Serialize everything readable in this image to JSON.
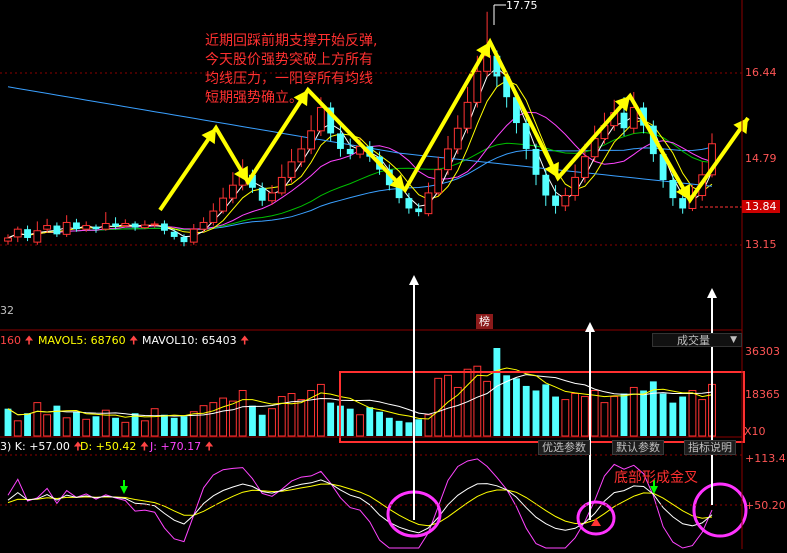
{
  "colors": {
    "bg": "#000000",
    "up": "#ff3333",
    "down": "#54ffff",
    "ma_white": "#ffffff",
    "ma_yellow": "#ffff00",
    "ma_magenta": "#ff44ff",
    "ma_green": "#00c000",
    "ma_blue": "#3aa0ff",
    "annotation": "#ff3030",
    "arrow_yellow": "#ffff00",
    "circle": "#ff33ff",
    "grid": "#8b0000"
  },
  "price_panel": {
    "high_marker": "17.75",
    "axis_labels": [
      "16.44",
      "14.79",
      "13.84",
      "13.15"
    ],
    "current_price": "13.84",
    "cut_label": "32",
    "annotation": [
      "近期回踩前期支撑开始反弹,",
      "今天股价强势突破上方所有",
      "均线压力，一阳穿所有均线",
      "短期强势确立。"
    ]
  },
  "volume_panel": {
    "legend": [
      {
        "text": "160",
        "color": "#ff4444"
      },
      {
        "text": "MAVOL5: 68760",
        "color": "#ffff00"
      },
      {
        "text": "MAVOL10: 65403",
        "color": "#ffffff"
      }
    ],
    "badge": "榜",
    "dropdown": "成交量",
    "axis_labels": [
      "36303",
      "18365",
      "X10"
    ],
    "buttons": [
      "优选参数",
      "默认参数",
      "指标说明"
    ]
  },
  "kdj_panel": {
    "legend": [
      {
        "text": "3) K: +57.00",
        "color": "#ffffff"
      },
      {
        "text": "D: +50.42",
        "color": "#ffff00"
      },
      {
        "text": "J: +70.17",
        "color": "#ff44ff"
      }
    ],
    "axis_labels": [
      "+113.4",
      "+50.20"
    ],
    "annotation": "底部形成金叉"
  },
  "chart_data": {
    "type": "candlestick",
    "ylim": [
      12.8,
      17.9
    ],
    "candles": [
      {
        "o": 13.32,
        "c": 13.38,
        "h": 13.45,
        "l": 13.25
      },
      {
        "o": 13.4,
        "c": 13.55,
        "h": 13.6,
        "l": 13.3
      },
      {
        "o": 13.55,
        "c": 13.38,
        "h": 13.62,
        "l": 13.32
      },
      {
        "o": 13.3,
        "c": 13.52,
        "h": 13.7,
        "l": 13.25
      },
      {
        "o": 13.55,
        "c": 13.62,
        "h": 13.75,
        "l": 13.48
      },
      {
        "o": 13.62,
        "c": 13.45,
        "h": 13.68,
        "l": 13.4
      },
      {
        "o": 13.45,
        "c": 13.68,
        "h": 13.82,
        "l": 13.4
      },
      {
        "o": 13.68,
        "c": 13.55,
        "h": 13.75,
        "l": 13.5
      },
      {
        "o": 13.55,
        "c": 13.62,
        "h": 13.7,
        "l": 13.5
      },
      {
        "o": 13.6,
        "c": 13.55,
        "h": 13.64,
        "l": 13.48
      },
      {
        "o": 13.55,
        "c": 13.66,
        "h": 13.88,
        "l": 13.52
      },
      {
        "o": 13.66,
        "c": 13.6,
        "h": 13.78,
        "l": 13.55
      },
      {
        "o": 13.62,
        "c": 13.66,
        "h": 13.74,
        "l": 13.58
      },
      {
        "o": 13.66,
        "c": 13.58,
        "h": 13.7,
        "l": 13.52
      },
      {
        "o": 13.58,
        "c": 13.63,
        "h": 13.72,
        "l": 13.55
      },
      {
        "o": 13.63,
        "c": 13.65,
        "h": 13.7,
        "l": 13.58
      },
      {
        "o": 13.66,
        "c": 13.52,
        "h": 13.72,
        "l": 13.45
      },
      {
        "o": 13.5,
        "c": 13.4,
        "h": 13.55,
        "l": 13.35
      },
      {
        "o": 13.4,
        "c": 13.3,
        "h": 13.45,
        "l": 13.22
      },
      {
        "o": 13.3,
        "c": 13.55,
        "h": 13.65,
        "l": 13.25
      },
      {
        "o": 13.55,
        "c": 13.68,
        "h": 13.78,
        "l": 13.5
      },
      {
        "o": 13.68,
        "c": 13.9,
        "h": 14.05,
        "l": 13.62
      },
      {
        "o": 13.9,
        "c": 14.15,
        "h": 14.35,
        "l": 13.85
      },
      {
        "o": 14.15,
        "c": 14.4,
        "h": 14.65,
        "l": 14.05
      },
      {
        "o": 14.4,
        "c": 14.65,
        "h": 14.9,
        "l": 14.3
      },
      {
        "o": 14.6,
        "c": 14.35,
        "h": 14.7,
        "l": 14.25
      },
      {
        "o": 14.35,
        "c": 14.1,
        "h": 14.45,
        "l": 14.0
      },
      {
        "o": 14.1,
        "c": 14.25,
        "h": 14.4,
        "l": 14.02
      },
      {
        "o": 14.25,
        "c": 14.55,
        "h": 14.8,
        "l": 14.2
      },
      {
        "o": 14.55,
        "c": 14.85,
        "h": 15.1,
        "l": 14.45
      },
      {
        "o": 14.85,
        "c": 15.1,
        "h": 15.35,
        "l": 14.75
      },
      {
        "o": 15.1,
        "c": 15.45,
        "h": 15.75,
        "l": 15.0
      },
      {
        "o": 15.45,
        "c": 15.9,
        "h": 16.1,
        "l": 15.35
      },
      {
        "o": 15.9,
        "c": 15.4,
        "h": 16.0,
        "l": 15.25
      },
      {
        "o": 15.4,
        "c": 15.1,
        "h": 15.55,
        "l": 14.95
      },
      {
        "o": 15.1,
        "c": 15.0,
        "h": 15.3,
        "l": 14.9
      },
      {
        "o": 15.0,
        "c": 15.15,
        "h": 15.3,
        "l": 14.92
      },
      {
        "o": 15.15,
        "c": 14.95,
        "h": 15.25,
        "l": 14.85
      },
      {
        "o": 14.95,
        "c": 14.7,
        "h": 15.05,
        "l": 14.6
      },
      {
        "o": 14.7,
        "c": 14.4,
        "h": 14.8,
        "l": 14.3
      },
      {
        "o": 14.4,
        "c": 14.15,
        "h": 14.5,
        "l": 14.05
      },
      {
        "o": 14.15,
        "c": 13.95,
        "h": 14.25,
        "l": 13.85
      },
      {
        "o": 13.95,
        "c": 13.88,
        "h": 14.05,
        "l": 13.8
      },
      {
        "o": 13.85,
        "c": 14.25,
        "h": 14.45,
        "l": 13.8
      },
      {
        "o": 14.25,
        "c": 14.7,
        "h": 14.95,
        "l": 14.2
      },
      {
        "o": 14.7,
        "c": 15.1,
        "h": 15.35,
        "l": 14.6
      },
      {
        "o": 15.1,
        "c": 15.5,
        "h": 15.75,
        "l": 15.0
      },
      {
        "o": 15.5,
        "c": 16.0,
        "h": 16.3,
        "l": 15.4
      },
      {
        "o": 16.0,
        "c": 16.6,
        "h": 16.9,
        "l": 15.9
      },
      {
        "o": 16.6,
        "c": 16.9,
        "h": 17.75,
        "l": 16.5
      },
      {
        "o": 16.9,
        "c": 16.5,
        "h": 17.0,
        "l": 16.3
      },
      {
        "o": 16.5,
        "c": 16.1,
        "h": 16.6,
        "l": 15.9
      },
      {
        "o": 16.1,
        "c": 15.6,
        "h": 16.2,
        "l": 15.4
      },
      {
        "o": 15.6,
        "c": 15.1,
        "h": 15.7,
        "l": 14.9
      },
      {
        "o": 15.1,
        "c": 14.6,
        "h": 15.2,
        "l": 14.4
      },
      {
        "o": 14.6,
        "c": 14.2,
        "h": 14.7,
        "l": 14.0
      },
      {
        "o": 14.2,
        "c": 14.0,
        "h": 14.4,
        "l": 13.85
      },
      {
        "o": 14.0,
        "c": 14.2,
        "h": 14.35,
        "l": 13.9
      },
      {
        "o": 14.2,
        "c": 14.55,
        "h": 14.8,
        "l": 14.1
      },
      {
        "o": 14.55,
        "c": 14.95,
        "h": 15.2,
        "l": 14.45
      },
      {
        "o": 14.95,
        "c": 15.3,
        "h": 15.55,
        "l": 14.85
      },
      {
        "o": 15.3,
        "c": 15.55,
        "h": 15.8,
        "l": 15.2
      },
      {
        "o": 15.55,
        "c": 15.8,
        "h": 16.05,
        "l": 15.45
      },
      {
        "o": 15.8,
        "c": 15.5,
        "h": 16.1,
        "l": 15.35
      },
      {
        "o": 15.5,
        "c": 15.9,
        "h": 16.2,
        "l": 15.4
      },
      {
        "o": 15.9,
        "c": 15.55,
        "h": 16.0,
        "l": 15.4
      },
      {
        "o": 15.55,
        "c": 15.0,
        "h": 15.65,
        "l": 14.85
      },
      {
        "o": 15.0,
        "c": 14.5,
        "h": 15.1,
        "l": 14.35
      },
      {
        "o": 14.5,
        "c": 14.15,
        "h": 14.65,
        "l": 14.0
      },
      {
        "o": 14.15,
        "c": 13.95,
        "h": 14.25,
        "l": 13.85
      },
      {
        "o": 13.95,
        "c": 14.2,
        "h": 14.4,
        "l": 13.9
      },
      {
        "o": 14.2,
        "c": 14.6,
        "h": 14.85,
        "l": 14.1
      },
      {
        "o": 14.6,
        "c": 15.2,
        "h": 15.4,
        "l": 14.55
      }
    ],
    "volume": [
      18,
      10,
      15,
      22,
      14,
      20,
      12,
      16,
      11,
      13,
      17,
      12,
      9,
      15,
      10,
      18,
      14,
      12,
      13,
      16,
      20,
      22,
      25,
      23,
      30,
      20,
      14,
      18,
      26,
      28,
      24,
      30,
      34,
      22,
      20,
      18,
      14,
      19,
      16,
      12,
      10,
      9,
      11,
      14,
      38,
      40,
      32,
      44,
      46,
      36,
      58,
      40,
      38,
      33,
      30,
      34,
      26,
      24,
      28,
      26,
      30,
      22,
      26,
      28,
      32,
      30,
      36,
      28,
      22,
      26,
      30,
      24,
      34
    ],
    "volume_dir": [
      0,
      1,
      0,
      1,
      1,
      0,
      1,
      0,
      1,
      0,
      1,
      0,
      1,
      0,
      1,
      1,
      0,
      0,
      0,
      1,
      1,
      1,
      1,
      1,
      1,
      0,
      0,
      1,
      1,
      1,
      1,
      1,
      1,
      0,
      0,
      0,
      1,
      0,
      0,
      0,
      0,
      0,
      0,
      1,
      1,
      1,
      1,
      1,
      1,
      1,
      0,
      0,
      0,
      0,
      0,
      0,
      0,
      1,
      1,
      1,
      1,
      1,
      1,
      0,
      1,
      0,
      0,
      0,
      0,
      0,
      1,
      1,
      1
    ]
  }
}
